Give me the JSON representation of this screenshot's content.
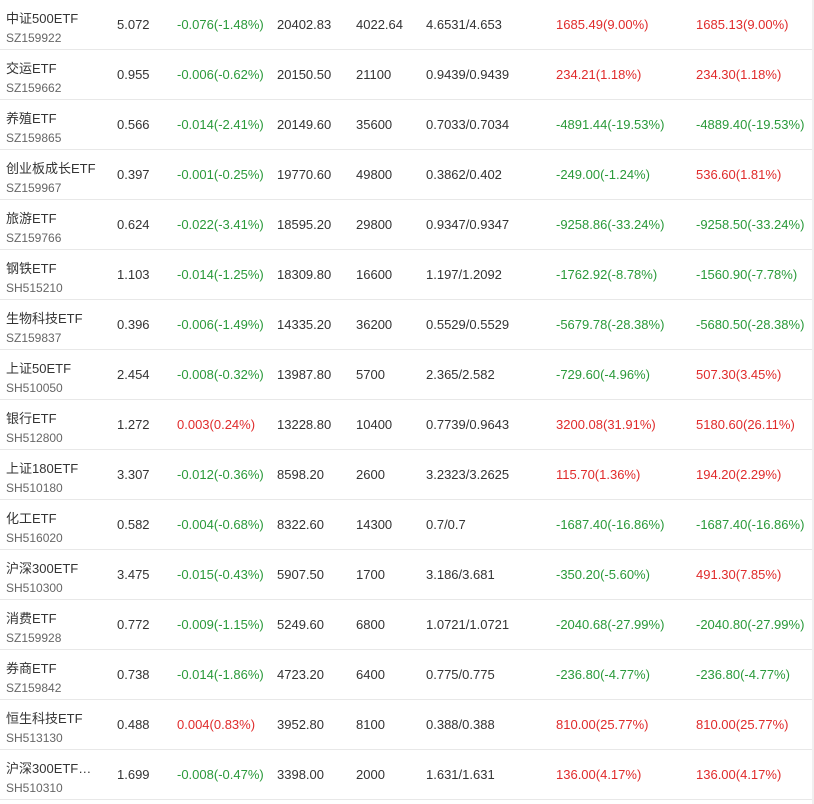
{
  "colors": {
    "up": "#e02b2b",
    "down": "#2a9a3a",
    "text": "#333333",
    "subtext": "#666666"
  },
  "rows": [
    {
      "name": "中证500ETF",
      "code": "SZ159922",
      "price": "5.072",
      "change": "-0.076(-1.48%)",
      "change_dir": "down",
      "amount": "20402.83",
      "shares": "4022.64",
      "cost": "4.6531/4.653",
      "pnl1": "1685.49(9.00%)",
      "pnl1_dir": "up",
      "pnl2": "1685.13(9.00%)",
      "pnl2_dir": "up"
    },
    {
      "name": "交运ETF",
      "code": "SZ159662",
      "price": "0.955",
      "change": "-0.006(-0.62%)",
      "change_dir": "down",
      "amount": "20150.50",
      "shares": "21100",
      "cost": "0.9439/0.9439",
      "pnl1": "234.21(1.18%)",
      "pnl1_dir": "up",
      "pnl2": "234.30(1.18%)",
      "pnl2_dir": "up"
    },
    {
      "name": "养殖ETF",
      "code": "SZ159865",
      "price": "0.566",
      "change": "-0.014(-2.41%)",
      "change_dir": "down",
      "amount": "20149.60",
      "shares": "35600",
      "cost": "0.7033/0.7034",
      "pnl1": "-4891.44(-19.53%)",
      "pnl1_dir": "down",
      "pnl2": "-4889.40(-19.53%)",
      "pnl2_dir": "down"
    },
    {
      "name": "创业板成长ETF",
      "code": "SZ159967",
      "price": "0.397",
      "change": "-0.001(-0.25%)",
      "change_dir": "down",
      "amount": "19770.60",
      "shares": "49800",
      "cost": "0.3862/0.402",
      "pnl1": "-249.00(-1.24%)",
      "pnl1_dir": "down",
      "pnl2": "536.60(1.81%)",
      "pnl2_dir": "up"
    },
    {
      "name": "旅游ETF",
      "code": "SZ159766",
      "price": "0.624",
      "change": "-0.022(-3.41%)",
      "change_dir": "down",
      "amount": "18595.20",
      "shares": "29800",
      "cost": "0.9347/0.9347",
      "pnl1": "-9258.86(-33.24%)",
      "pnl1_dir": "down",
      "pnl2": "-9258.50(-33.24%)",
      "pnl2_dir": "down"
    },
    {
      "name": "钢铁ETF",
      "code": "SH515210",
      "price": "1.103",
      "change": "-0.014(-1.25%)",
      "change_dir": "down",
      "amount": "18309.80",
      "shares": "16600",
      "cost": "1.197/1.2092",
      "pnl1": "-1762.92(-8.78%)",
      "pnl1_dir": "down",
      "pnl2": "-1560.90(-7.78%)",
      "pnl2_dir": "down"
    },
    {
      "name": "生物科技ETF",
      "code": "SZ159837",
      "price": "0.396",
      "change": "-0.006(-1.49%)",
      "change_dir": "down",
      "amount": "14335.20",
      "shares": "36200",
      "cost": "0.5529/0.5529",
      "pnl1": "-5679.78(-28.38%)",
      "pnl1_dir": "down",
      "pnl2": "-5680.50(-28.38%)",
      "pnl2_dir": "down"
    },
    {
      "name": "上证50ETF",
      "code": "SH510050",
      "price": "2.454",
      "change": "-0.008(-0.32%)",
      "change_dir": "down",
      "amount": "13987.80",
      "shares": "5700",
      "cost": "2.365/2.582",
      "pnl1": "-729.60(-4.96%)",
      "pnl1_dir": "down",
      "pnl2": "507.30(3.45%)",
      "pnl2_dir": "up"
    },
    {
      "name": "银行ETF",
      "code": "SH512800",
      "price": "1.272",
      "change": "0.003(0.24%)",
      "change_dir": "up",
      "amount": "13228.80",
      "shares": "10400",
      "cost": "0.7739/0.9643",
      "pnl1": "3200.08(31.91%)",
      "pnl1_dir": "up",
      "pnl2": "5180.60(26.11%)",
      "pnl2_dir": "up"
    },
    {
      "name": "上证180ETF",
      "code": "SH510180",
      "price": "3.307",
      "change": "-0.012(-0.36%)",
      "change_dir": "down",
      "amount": "8598.20",
      "shares": "2600",
      "cost": "3.2323/3.2625",
      "pnl1": "115.70(1.36%)",
      "pnl1_dir": "up",
      "pnl2": "194.20(2.29%)",
      "pnl2_dir": "up"
    },
    {
      "name": "化工ETF",
      "code": "SH516020",
      "price": "0.582",
      "change": "-0.004(-0.68%)",
      "change_dir": "down",
      "amount": "8322.60",
      "shares": "14300",
      "cost": "0.7/0.7",
      "pnl1": "-1687.40(-16.86%)",
      "pnl1_dir": "down",
      "pnl2": "-1687.40(-16.86%)",
      "pnl2_dir": "down"
    },
    {
      "name": "沪深300ETF",
      "code": "SH510300",
      "price": "3.475",
      "change": "-0.015(-0.43%)",
      "change_dir": "down",
      "amount": "5907.50",
      "shares": "1700",
      "cost": "3.186/3.681",
      "pnl1": "-350.20(-5.60%)",
      "pnl1_dir": "down",
      "pnl2": "491.30(7.85%)",
      "pnl2_dir": "up"
    },
    {
      "name": "消费ETF",
      "code": "SZ159928",
      "price": "0.772",
      "change": "-0.009(-1.15%)",
      "change_dir": "down",
      "amount": "5249.60",
      "shares": "6800",
      "cost": "1.0721/1.0721",
      "pnl1": "-2040.68(-27.99%)",
      "pnl1_dir": "down",
      "pnl2": "-2040.80(-27.99%)",
      "pnl2_dir": "down"
    },
    {
      "name": "券商ETF",
      "code": "SZ159842",
      "price": "0.738",
      "change": "-0.014(-1.86%)",
      "change_dir": "down",
      "amount": "4723.20",
      "shares": "6400",
      "cost": "0.775/0.775",
      "pnl1": "-236.80(-4.77%)",
      "pnl1_dir": "down",
      "pnl2": "-236.80(-4.77%)",
      "pnl2_dir": "down"
    },
    {
      "name": "恒生科技ETF",
      "code": "SH513130",
      "price": "0.488",
      "change": "0.004(0.83%)",
      "change_dir": "up",
      "amount": "3952.80",
      "shares": "8100",
      "cost": "0.388/0.388",
      "pnl1": "810.00(25.77%)",
      "pnl1_dir": "up",
      "pnl2": "810.00(25.77%)",
      "pnl2_dir": "up"
    },
    {
      "name": "沪深300ETF…",
      "code": "SH510310",
      "price": "1.699",
      "change": "-0.008(-0.47%)",
      "change_dir": "down",
      "amount": "3398.00",
      "shares": "2000",
      "cost": "1.631/1.631",
      "pnl1": "136.00(4.17%)",
      "pnl1_dir": "up",
      "pnl2": "136.00(4.17%)",
      "pnl2_dir": "up"
    }
  ]
}
